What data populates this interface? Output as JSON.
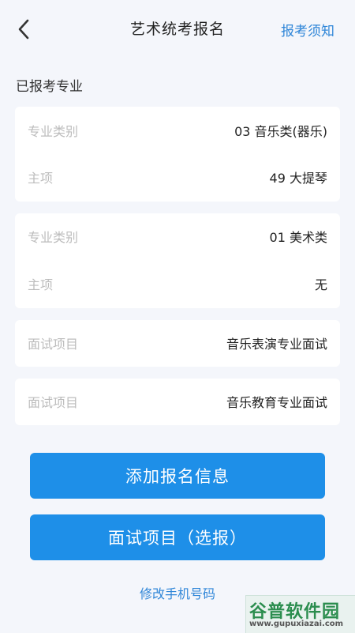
{
  "header": {
    "title": "艺术统考报名",
    "notice_link": "报考须知"
  },
  "section_title": "已报考专业",
  "cards": [
    {
      "rows": [
        {
          "label": "专业类别",
          "value": "03 音乐类(器乐)"
        },
        {
          "label": "主项",
          "value": "49 大提琴"
        }
      ]
    },
    {
      "rows": [
        {
          "label": "专业类别",
          "value": "01 美术类"
        },
        {
          "label": "主项",
          "value": "无"
        }
      ]
    },
    {
      "rows": [
        {
          "label": "面试项目",
          "value": "音乐表演专业面试"
        }
      ]
    },
    {
      "rows": [
        {
          "label": "面试项目",
          "value": "音乐教育专业面试"
        }
      ]
    }
  ],
  "buttons": {
    "add_registration": "添加报名信息",
    "interview_select": "面试项目（选报）"
  },
  "change_phone_link": "修改手机号码",
  "watermark": {
    "main": "谷普软件园",
    "url": "www.gupuxiazai.com"
  },
  "colors": {
    "accent": "#1e8fe8",
    "link": "#2f86d8",
    "background": "#f4f6fb"
  },
  "icons": {
    "back": "chevron-left-icon"
  }
}
